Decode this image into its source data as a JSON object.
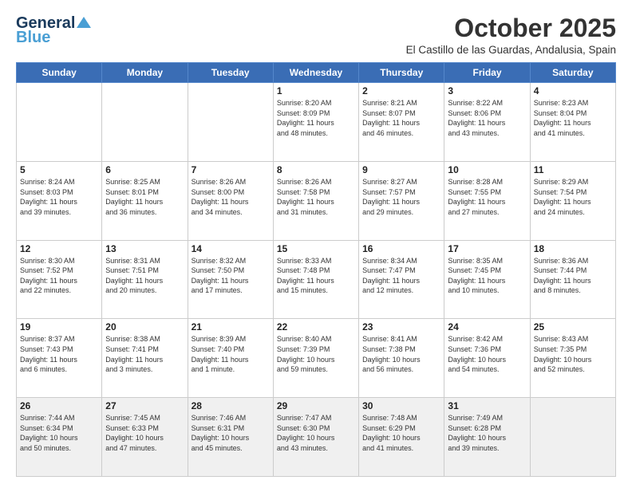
{
  "logo": {
    "line1": "General",
    "line2": "Blue"
  },
  "title": "October 2025",
  "location": "El Castillo de las Guardas, Andalusia, Spain",
  "weekdays": [
    "Sunday",
    "Monday",
    "Tuesday",
    "Wednesday",
    "Thursday",
    "Friday",
    "Saturday"
  ],
  "weeks": [
    [
      {
        "day": "",
        "info": ""
      },
      {
        "day": "",
        "info": ""
      },
      {
        "day": "",
        "info": ""
      },
      {
        "day": "1",
        "info": "Sunrise: 8:20 AM\nSunset: 8:09 PM\nDaylight: 11 hours\nand 48 minutes."
      },
      {
        "day": "2",
        "info": "Sunrise: 8:21 AM\nSunset: 8:07 PM\nDaylight: 11 hours\nand 46 minutes."
      },
      {
        "day": "3",
        "info": "Sunrise: 8:22 AM\nSunset: 8:06 PM\nDaylight: 11 hours\nand 43 minutes."
      },
      {
        "day": "4",
        "info": "Sunrise: 8:23 AM\nSunset: 8:04 PM\nDaylight: 11 hours\nand 41 minutes."
      }
    ],
    [
      {
        "day": "5",
        "info": "Sunrise: 8:24 AM\nSunset: 8:03 PM\nDaylight: 11 hours\nand 39 minutes."
      },
      {
        "day": "6",
        "info": "Sunrise: 8:25 AM\nSunset: 8:01 PM\nDaylight: 11 hours\nand 36 minutes."
      },
      {
        "day": "7",
        "info": "Sunrise: 8:26 AM\nSunset: 8:00 PM\nDaylight: 11 hours\nand 34 minutes."
      },
      {
        "day": "8",
        "info": "Sunrise: 8:26 AM\nSunset: 7:58 PM\nDaylight: 11 hours\nand 31 minutes."
      },
      {
        "day": "9",
        "info": "Sunrise: 8:27 AM\nSunset: 7:57 PM\nDaylight: 11 hours\nand 29 minutes."
      },
      {
        "day": "10",
        "info": "Sunrise: 8:28 AM\nSunset: 7:55 PM\nDaylight: 11 hours\nand 27 minutes."
      },
      {
        "day": "11",
        "info": "Sunrise: 8:29 AM\nSunset: 7:54 PM\nDaylight: 11 hours\nand 24 minutes."
      }
    ],
    [
      {
        "day": "12",
        "info": "Sunrise: 8:30 AM\nSunset: 7:52 PM\nDaylight: 11 hours\nand 22 minutes."
      },
      {
        "day": "13",
        "info": "Sunrise: 8:31 AM\nSunset: 7:51 PM\nDaylight: 11 hours\nand 20 minutes."
      },
      {
        "day": "14",
        "info": "Sunrise: 8:32 AM\nSunset: 7:50 PM\nDaylight: 11 hours\nand 17 minutes."
      },
      {
        "day": "15",
        "info": "Sunrise: 8:33 AM\nSunset: 7:48 PM\nDaylight: 11 hours\nand 15 minutes."
      },
      {
        "day": "16",
        "info": "Sunrise: 8:34 AM\nSunset: 7:47 PM\nDaylight: 11 hours\nand 12 minutes."
      },
      {
        "day": "17",
        "info": "Sunrise: 8:35 AM\nSunset: 7:45 PM\nDaylight: 11 hours\nand 10 minutes."
      },
      {
        "day": "18",
        "info": "Sunrise: 8:36 AM\nSunset: 7:44 PM\nDaylight: 11 hours\nand 8 minutes."
      }
    ],
    [
      {
        "day": "19",
        "info": "Sunrise: 8:37 AM\nSunset: 7:43 PM\nDaylight: 11 hours\nand 6 minutes."
      },
      {
        "day": "20",
        "info": "Sunrise: 8:38 AM\nSunset: 7:41 PM\nDaylight: 11 hours\nand 3 minutes."
      },
      {
        "day": "21",
        "info": "Sunrise: 8:39 AM\nSunset: 7:40 PM\nDaylight: 11 hours\nand 1 minute."
      },
      {
        "day": "22",
        "info": "Sunrise: 8:40 AM\nSunset: 7:39 PM\nDaylight: 10 hours\nand 59 minutes."
      },
      {
        "day": "23",
        "info": "Sunrise: 8:41 AM\nSunset: 7:38 PM\nDaylight: 10 hours\nand 56 minutes."
      },
      {
        "day": "24",
        "info": "Sunrise: 8:42 AM\nSunset: 7:36 PM\nDaylight: 10 hours\nand 54 minutes."
      },
      {
        "day": "25",
        "info": "Sunrise: 8:43 AM\nSunset: 7:35 PM\nDaylight: 10 hours\nand 52 minutes."
      }
    ],
    [
      {
        "day": "26",
        "info": "Sunrise: 7:44 AM\nSunset: 6:34 PM\nDaylight: 10 hours\nand 50 minutes."
      },
      {
        "day": "27",
        "info": "Sunrise: 7:45 AM\nSunset: 6:33 PM\nDaylight: 10 hours\nand 47 minutes."
      },
      {
        "day": "28",
        "info": "Sunrise: 7:46 AM\nSunset: 6:31 PM\nDaylight: 10 hours\nand 45 minutes."
      },
      {
        "day": "29",
        "info": "Sunrise: 7:47 AM\nSunset: 6:30 PM\nDaylight: 10 hours\nand 43 minutes."
      },
      {
        "day": "30",
        "info": "Sunrise: 7:48 AM\nSunset: 6:29 PM\nDaylight: 10 hours\nand 41 minutes."
      },
      {
        "day": "31",
        "info": "Sunrise: 7:49 AM\nSunset: 6:28 PM\nDaylight: 10 hours\nand 39 minutes."
      },
      {
        "day": "",
        "info": ""
      }
    ]
  ]
}
